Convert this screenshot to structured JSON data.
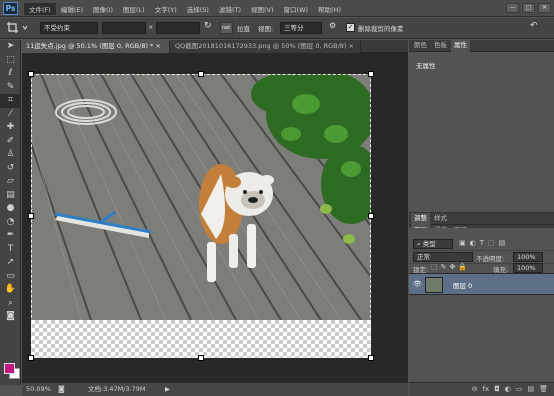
{
  "app": {
    "logo": "Ps"
  },
  "menu": [
    "文件(F)",
    "编辑(E)",
    "图像(I)",
    "图层(L)",
    "文字(Y)",
    "选择(S)",
    "滤镜(T)",
    "视图(V)",
    "窗口(W)",
    "帮助(H)"
  ],
  "window_buttons": [
    "—",
    "□",
    "✕"
  ],
  "options": {
    "tool_icon": "crop-icon",
    "ratio_select": "不受约束",
    "swap": "×",
    "straighten": "拉直",
    "view_label": "视图:",
    "view_select": "三等分",
    "delete_cropped": "删除裁剪的像素",
    "checked": "✓"
  },
  "tabs": [
    {
      "label": "11运失点.jpg @ 50.1% (图层 0, RGB/8) *",
      "active": true,
      "close": "×"
    },
    {
      "label": "QQ截图20181016172933.png @ 50% (图层 0, RGB/8)",
      "active": false,
      "close": "×"
    }
  ],
  "status": {
    "zoom": "50.09%",
    "doc": "文档:3.47M/3.79M"
  },
  "panels": {
    "top_tabs": [
      "颜色",
      "色板",
      "属性"
    ],
    "no_properties": "无属性",
    "mid_tabs": [
      "调整",
      "样式"
    ],
    "layer_tabs": [
      "图层",
      "通道",
      "路径"
    ],
    "kind": "类型",
    "blend_mode": "正常",
    "opacity_label": "不透明度:",
    "opacity": "100%",
    "lock_label": "锁定:",
    "fill_label": "填充:",
    "fill": "100%",
    "layer_name": "图层 0",
    "footer_icons": [
      "⊖",
      "fx",
      "◘",
      "◐",
      "▭",
      "▤",
      "🗑"
    ]
  },
  "colors": {
    "foreground": "#c2187f",
    "background": "#ffffff",
    "accent": "#5d6f87"
  }
}
